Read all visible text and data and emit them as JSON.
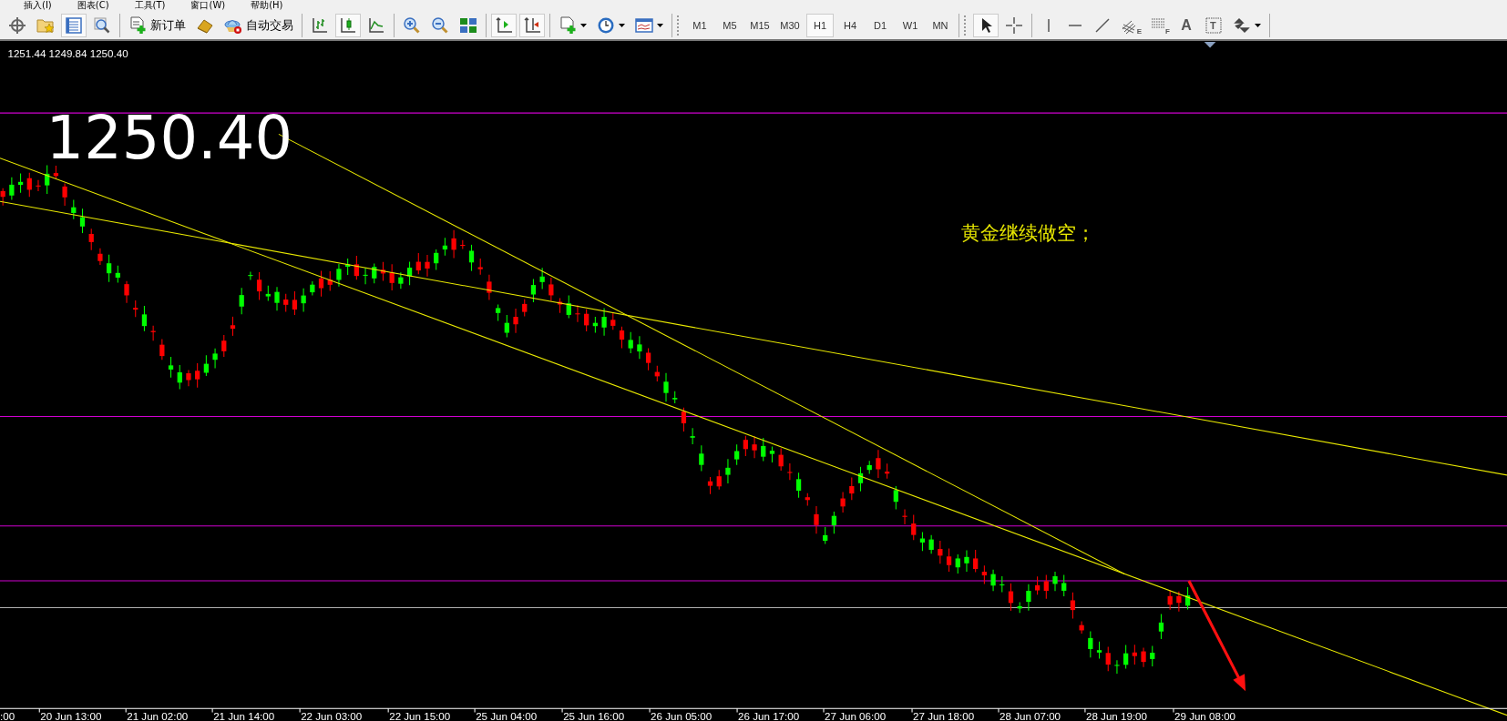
{
  "menu": [
    {
      "label": "插入(I)"
    },
    {
      "label": "图表(C)"
    },
    {
      "label": "工具(T)"
    },
    {
      "label": "窗口(W)"
    },
    {
      "label": "帮助(H)"
    }
  ],
  "toolbar": {
    "groups_left": [
      [
        {
          "kind": "icon",
          "pressed": false
        },
        {
          "kind": "icon",
          "pressed": false
        },
        {
          "kind": "icon",
          "pressed": true
        },
        {
          "kind": "icon",
          "pressed": false
        }
      ],
      [
        {
          "kind": "labeled",
          "label": "新订单",
          "pressed": false
        },
        {
          "kind": "icon",
          "pressed": false
        },
        {
          "kind": "labeled",
          "label": "自动交易",
          "pressed": false
        }
      ],
      [
        {
          "kind": "icon",
          "pressed": false
        },
        {
          "kind": "icon",
          "pressed": true
        },
        {
          "kind": "icon",
          "pressed": false
        }
      ],
      [
        {
          "kind": "icon",
          "pressed": false
        },
        {
          "kind": "icon",
          "pressed": false
        },
        {
          "kind": "icon",
          "pressed": false
        }
      ],
      [
        {
          "kind": "icon",
          "pressed": true
        },
        {
          "kind": "icon",
          "pressed": true
        }
      ],
      [
        {
          "kind": "dropdown",
          "pressed": false
        },
        {
          "kind": "dropdown",
          "pressed": false
        },
        {
          "kind": "dropdown",
          "pressed": false
        }
      ]
    ],
    "timeframes": [
      {
        "label": "M1",
        "selected": false
      },
      {
        "label": "M5",
        "selected": false
      },
      {
        "label": "M15",
        "selected": false
      },
      {
        "label": "M30",
        "selected": false
      },
      {
        "label": "H1",
        "selected": true
      },
      {
        "label": "H4",
        "selected": false
      },
      {
        "label": "D1",
        "selected": false
      },
      {
        "label": "W1",
        "selected": false
      },
      {
        "label": "MN",
        "selected": false
      }
    ],
    "groups_right": [
      [
        {
          "kind": "icon",
          "pressed": true
        },
        {
          "kind": "icon",
          "pressed": false
        }
      ],
      [
        {
          "kind": "icon",
          "pressed": false
        },
        {
          "kind": "icon",
          "pressed": false
        },
        {
          "kind": "icon",
          "pressed": false
        },
        {
          "kind": "icon",
          "pressed": false,
          "glyph": "E"
        },
        {
          "kind": "icon",
          "pressed": false,
          "glyph": "F"
        },
        {
          "kind": "icon",
          "pressed": false,
          "glyph": "A"
        },
        {
          "kind": "icon",
          "pressed": false,
          "glyph": "T"
        },
        {
          "kind": "dropdown",
          "pressed": false
        }
      ]
    ]
  },
  "chart": {
    "ohlc": "1251.44 1249.84 1250.40",
    "price_label": "1250.40",
    "note": "黄金继续做空；",
    "time_axis": [
      ":00",
      "20 Jun 13:00",
      "21 Jun 02:00",
      "21 Jun 14:00",
      "22 Jun 03:00",
      "22 Jun 15:00",
      "25 Jun 04:00",
      "25 Jun 16:00",
      "26 Jun 05:00",
      "26 Jun 17:00",
      "27 Jun 06:00",
      "27 Jun 18:00",
      "28 Jun 07:00",
      "28 Jun 19:00",
      "29 Jun 08:00"
    ]
  }
}
